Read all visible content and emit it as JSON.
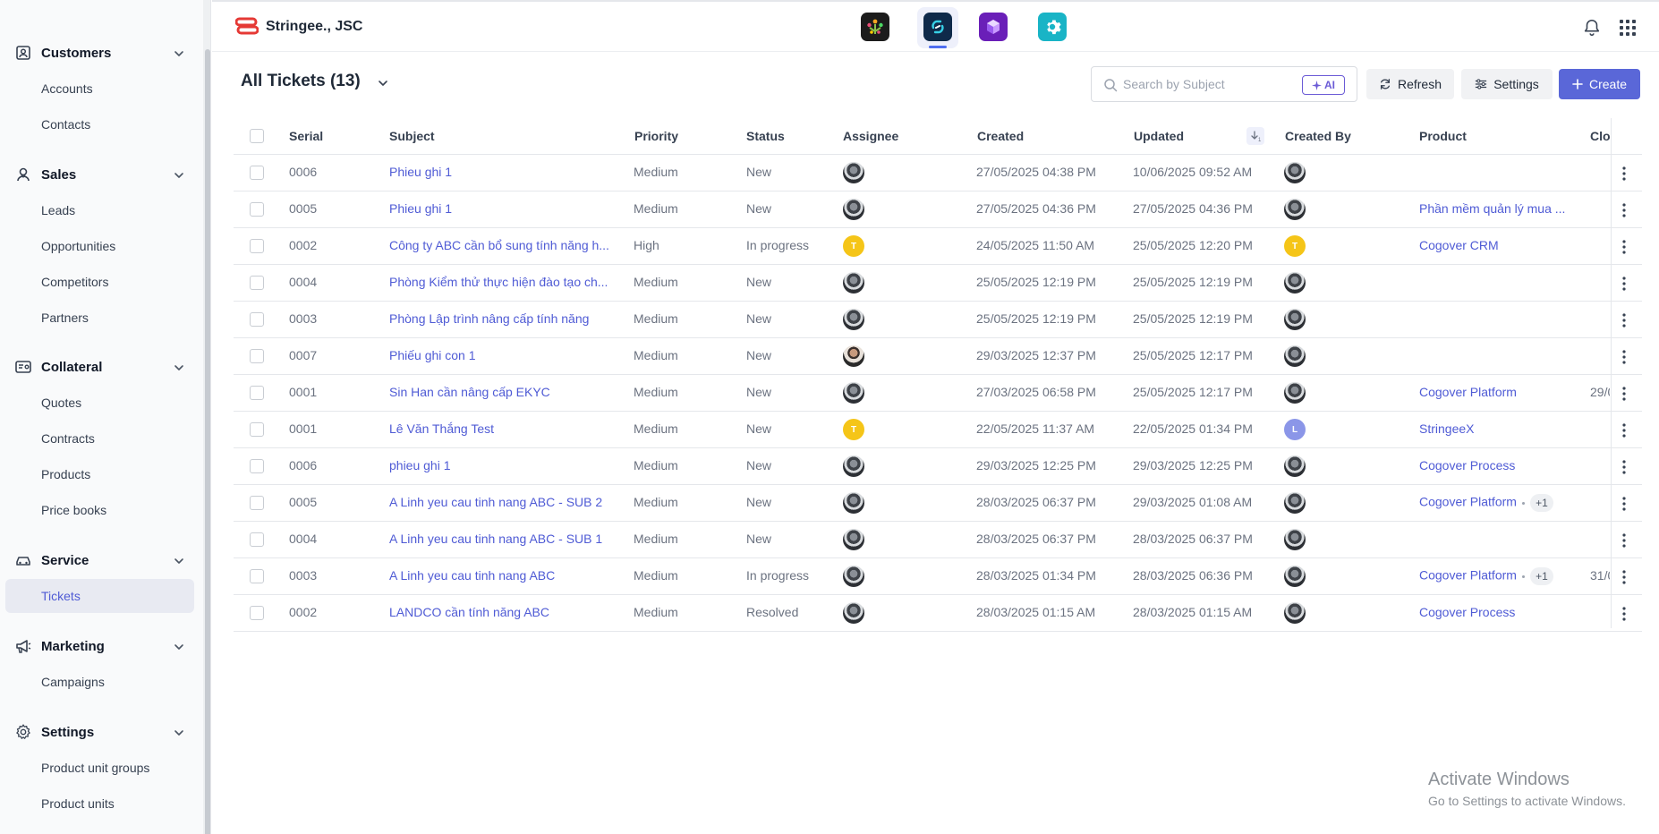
{
  "sidebar": {
    "groups": [
      {
        "label": "Customers",
        "icon": "contact-card-icon",
        "items": [
          "Accounts",
          "Contacts"
        ]
      },
      {
        "label": "Sales",
        "icon": "person-icon",
        "items": [
          "Leads",
          "Opportunities",
          "Competitors",
          "Partners"
        ]
      },
      {
        "label": "Collateral",
        "icon": "document-card-icon",
        "items": [
          "Quotes",
          "Contracts",
          "Products",
          "Price books"
        ]
      },
      {
        "label": "Service",
        "icon": "car-icon",
        "items": [
          "Tickets"
        ]
      },
      {
        "label": "Marketing",
        "icon": "megaphone-icon",
        "items": [
          "Campaigns"
        ]
      },
      {
        "label": "Settings",
        "icon": "gear-icon",
        "items": [
          "Product unit groups",
          "Product units"
        ]
      }
    ],
    "active_item": "Tickets"
  },
  "topbar": {
    "brand_name": "Stringee., JSC",
    "brand_color": "#e53935",
    "apps": [
      {
        "icon": "people-tree-app-icon",
        "bg": "#1c1c1c"
      },
      {
        "icon": "link-sync-app-icon",
        "bg": "#0f2a4a",
        "active": true
      },
      {
        "icon": "cube-app-icon",
        "bg": "#6a1fb8"
      },
      {
        "icon": "gear-app-icon",
        "bg": "#19b4c6"
      }
    ]
  },
  "page": {
    "title": "All Tickets (13)",
    "search_placeholder": "Search by Subject",
    "ai_label": "AI",
    "refresh_label": "Refresh",
    "settings_label": "Settings",
    "create_label": "Create",
    "accent": "#5a67d8"
  },
  "table": {
    "columns": [
      "Serial",
      "Subject",
      "Priority",
      "Status",
      "Assignee",
      "Created",
      "Updated",
      "Created By",
      "Product",
      "Clo"
    ],
    "sort_badge": "1",
    "rows": [
      {
        "serial": "0006",
        "subject": "Phieu ghi 1",
        "priority": "Medium",
        "status": "New",
        "assignee": "photo",
        "created": "27/05/2025 04:38 PM",
        "updated": "10/06/2025 09:52 AM",
        "created_by": "photo",
        "product": "",
        "extra": "",
        "closed": ""
      },
      {
        "serial": "0005",
        "subject": "Phieu ghi 1",
        "priority": "Medium",
        "status": "New",
        "assignee": "photo",
        "created": "27/05/2025 04:36 PM",
        "updated": "27/05/2025 04:36 PM",
        "created_by": "photo",
        "product": "Phần mềm quản lý mua ...",
        "extra": "",
        "closed": ""
      },
      {
        "serial": "0002",
        "subject": "Công ty ABC cần bổ sung tính năng h...",
        "priority": "High",
        "status": "In progress",
        "assignee": "T",
        "created": "24/05/2025 11:50 AM",
        "updated": "25/05/2025 12:20 PM",
        "created_by": "T",
        "product": "Cogover CRM",
        "extra": "",
        "closed": ""
      },
      {
        "serial": "0004",
        "subject": "Phòng Kiểm thử thực hiện đào tạo ch...",
        "priority": "Medium",
        "status": "New",
        "assignee": "photo",
        "created": "25/05/2025 12:19 PM",
        "updated": "25/05/2025 12:19 PM",
        "created_by": "photo",
        "product": "",
        "extra": "",
        "closed": ""
      },
      {
        "serial": "0003",
        "subject": "Phòng Lập trình nâng cấp tính năng",
        "priority": "Medium",
        "status": "New",
        "assignee": "photo",
        "created": "25/05/2025 12:19 PM",
        "updated": "25/05/2025 12:19 PM",
        "created_by": "photo",
        "product": "",
        "extra": "",
        "closed": ""
      },
      {
        "serial": "0007",
        "subject": "Phiếu ghi con 1",
        "priority": "Medium",
        "status": "New",
        "assignee": "photo2",
        "created": "29/03/2025 12:37 PM",
        "updated": "25/05/2025 12:17 PM",
        "created_by": "photo",
        "product": "",
        "extra": "",
        "closed": ""
      },
      {
        "serial": "0001",
        "subject": "Sin Han cần nâng cấp EKYC",
        "priority": "Medium",
        "status": "New",
        "assignee": "photo",
        "created": "27/03/2025 06:58 PM",
        "updated": "25/05/2025 12:17 PM",
        "created_by": "photo",
        "product": "Cogover Platform",
        "extra": "",
        "closed": "29/0"
      },
      {
        "serial": "0001",
        "subject": "Lê Văn Thắng Test",
        "priority": "Medium",
        "status": "New",
        "assignee": "T",
        "created": "22/05/2025 11:37 AM",
        "updated": "22/05/2025 01:34 PM",
        "created_by": "L",
        "product": "StringeeX",
        "extra": "",
        "closed": ""
      },
      {
        "serial": "0006",
        "subject": "phieu ghi 1",
        "priority": "Medium",
        "status": "New",
        "assignee": "photo",
        "created": "29/03/2025 12:25 PM",
        "updated": "29/03/2025 12:25 PM",
        "created_by": "photo",
        "product": "Cogover Process",
        "extra": "",
        "closed": ""
      },
      {
        "serial": "0005",
        "subject": "A Linh yeu cau tinh nang ABC - SUB 2",
        "priority": "Medium",
        "status": "New",
        "assignee": "photo",
        "created": "28/03/2025 06:37 PM",
        "updated": "29/03/2025 01:08 AM",
        "created_by": "photo",
        "product": "Cogover Platform",
        "extra": "+1",
        "closed": ""
      },
      {
        "serial": "0004",
        "subject": "A Linh yeu cau tinh nang ABC - SUB 1",
        "priority": "Medium",
        "status": "New",
        "assignee": "photo",
        "created": "28/03/2025 06:37 PM",
        "updated": "28/03/2025 06:37 PM",
        "created_by": "photo",
        "product": "",
        "extra": "",
        "closed": ""
      },
      {
        "serial": "0003",
        "subject": "A Linh yeu cau tinh nang ABC",
        "priority": "Medium",
        "status": "In progress",
        "assignee": "photo",
        "created": "28/03/2025 01:34 PM",
        "updated": "28/03/2025 06:36 PM",
        "created_by": "photo",
        "product": "Cogover Platform",
        "extra": "+1",
        "closed": "31/0"
      },
      {
        "serial": "0002",
        "subject": "LANDCO cần tính năng ABC",
        "priority": "Medium",
        "status": "Resolved",
        "assignee": "photo",
        "created": "28/03/2025 01:15 AM",
        "updated": "28/03/2025 01:15 AM",
        "created_by": "photo",
        "product": "Cogover Process",
        "extra": "",
        "closed": ""
      }
    ]
  },
  "watermark": {
    "line1": "Activate Windows",
    "line2": "Go to Settings to activate Windows."
  }
}
